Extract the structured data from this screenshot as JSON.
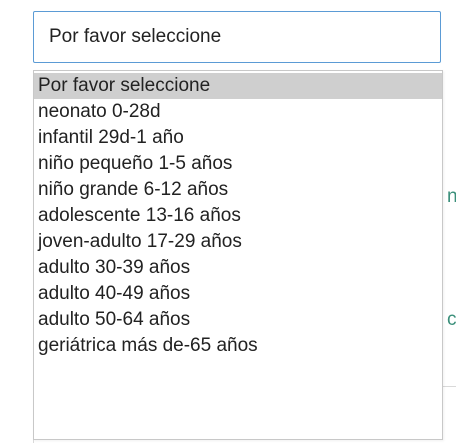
{
  "select": {
    "value": "Por favor seleccione"
  },
  "options": [
    "Por favor seleccione",
    "neonato 0-28d",
    "infantil 29d-1 año",
    "niño pequeño 1-5 años",
    "niño grande 6-12 años",
    "adolescente 13-16 años",
    "joven-adulto 17-29 años",
    "adulto 30-39 años",
    "adulto 40-49 años",
    "adulto 50-64 años",
    "geriátrica más de-65 años"
  ],
  "selected_index": 0,
  "background_fragments": [
    "n",
    "c"
  ]
}
